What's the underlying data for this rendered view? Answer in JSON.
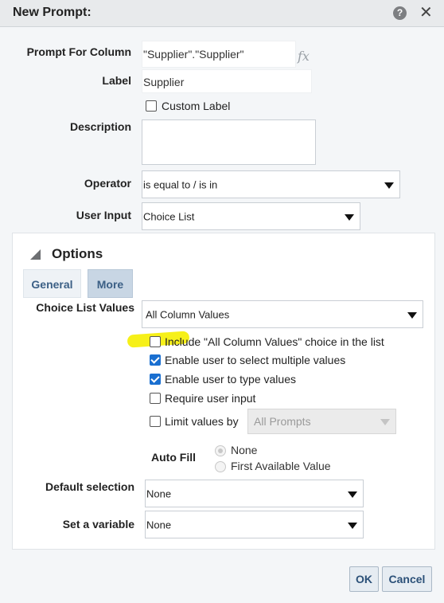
{
  "dialog": {
    "title": "New Prompt:",
    "help_icon": "question-circle-icon",
    "close_icon": "close-icon",
    "help_glyph": "?",
    "close_glyph": "✕"
  },
  "form": {
    "prompt_for_column_label": "Prompt For Column",
    "prompt_for_column_value": "\"Supplier\".\"Supplier\"",
    "fx_label": "fx",
    "label_label": "Label",
    "label_value": "Supplier",
    "custom_label_text": "Custom Label",
    "custom_label_checked": false,
    "description_label": "Description",
    "description_value": "",
    "operator_label": "Operator",
    "operator_value": "is equal to / is in",
    "user_input_label": "User Input",
    "user_input_value": "Choice List"
  },
  "options": {
    "title": "Options",
    "tabs": [
      {
        "label": "General",
        "active": false
      },
      {
        "label": "More",
        "active": true
      }
    ],
    "choice_list_values_label": "Choice List Values",
    "choice_list_values_value": "All Column Values",
    "checkboxes": [
      {
        "label": "Include \"All Column Values\" choice in the list",
        "checked": false
      },
      {
        "label": "Enable user to select multiple values",
        "checked": true
      },
      {
        "label": "Enable user to type values",
        "checked": true
      },
      {
        "label": "Require user input",
        "checked": false
      },
      {
        "label": "Limit values by",
        "checked": false
      }
    ],
    "limit_values_by_value": "All Prompts",
    "auto_fill_label": "Auto Fill",
    "auto_fill_options": [
      {
        "label": "None",
        "selected": true
      },
      {
        "label": "First Available Value",
        "selected": false
      }
    ],
    "default_selection_label": "Default selection",
    "default_selection_value": "None",
    "set_variable_label": "Set a variable",
    "set_variable_value": "None",
    "highlight_color": "#f5ee00"
  },
  "buttons": {
    "ok": "OK",
    "cancel": "Cancel"
  },
  "colors": {
    "checkbox_checked": "#1a6fd0",
    "tab_text": "#3b5f85",
    "more_tab_bg": "#c8d6e4"
  }
}
